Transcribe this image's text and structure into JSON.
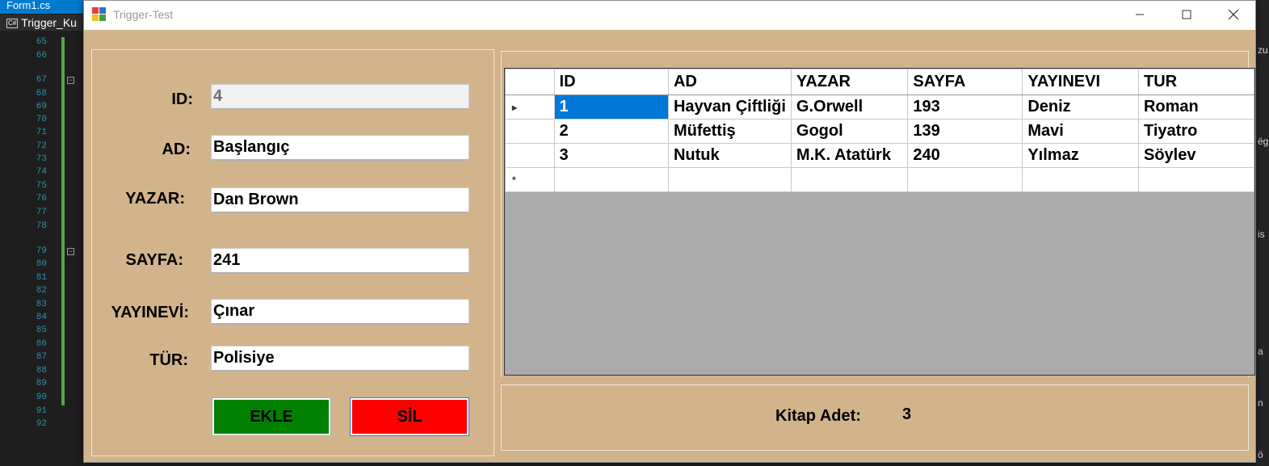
{
  "ide": {
    "tab1": "Form1.cs",
    "tab2": "Trigger_Ku",
    "tab2_badge": "C#",
    "line_numbers": [
      "65",
      "66",
      "67",
      "68",
      "69",
      "70",
      "71",
      "72",
      "73",
      "74",
      "75",
      "76",
      "77",
      "78",
      "79",
      "80",
      "81",
      "82",
      "83",
      "84",
      "85",
      "86",
      "87",
      "88",
      "89",
      "90",
      "91",
      "92"
    ],
    "right_fragments": [
      "zu",
      "ëg",
      "is",
      "a",
      "n",
      "ö"
    ]
  },
  "window": {
    "title": "Trigger-Test",
    "minimize_icon": "minimize-icon",
    "maximize_icon": "maximize-icon",
    "close_icon": "close-icon"
  },
  "form": {
    "id_label": "ID:",
    "id_value": "4",
    "ad_label": "AD:",
    "ad_value": "Başlangıç",
    "yazar_label": "YAZAR:",
    "yazar_value": "Dan Brown",
    "sayfa_label": "SAYFA:",
    "sayfa_value": "241",
    "yayinevi_label": "YAYINEVİ:",
    "yayinevi_value": "Çınar",
    "tur_label": "TÜR:",
    "tur_value": "Polisiye",
    "ekle_label": "EKLE",
    "sil_label": "SİL"
  },
  "grid": {
    "columns": [
      "ID",
      "AD",
      "YAZAR",
      "SAYFA",
      "YAYINEVI",
      "TUR"
    ],
    "rows": [
      [
        "1",
        "Hayvan Çiftliği",
        "G.Orwell",
        "193",
        "Deniz",
        "Roman"
      ],
      [
        "2",
        "Müfettiş",
        "Gogol",
        "139",
        "Mavi",
        "Tiyatro"
      ],
      [
        "3",
        "Nutuk",
        "M.K. Atatürk",
        "240",
        "Yılmaz",
        "Söylev"
      ]
    ],
    "current_row_marker": "▸",
    "new_row_marker": "*",
    "colors": {
      "selected": "#0078d7",
      "empty_area": "#ababab"
    }
  },
  "footer": {
    "count_label": "Kitap Adet:",
    "count_value": "3"
  },
  "colors": {
    "form_bg": "#d2b48c",
    "ekle_bg": "#008000",
    "sil_bg": "#ff0000"
  }
}
